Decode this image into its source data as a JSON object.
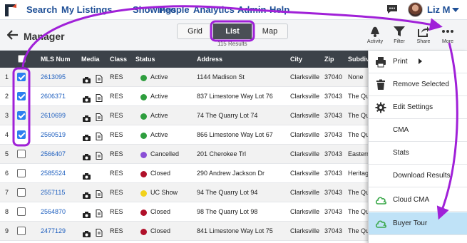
{
  "nav": {
    "links": [
      "Search",
      "My Listings",
      "Showings",
      "People",
      "Analytics",
      "Admin",
      "Help"
    ],
    "user": "Liz M"
  },
  "toolbar": {
    "title": "Manager",
    "views": [
      "Grid",
      "List",
      "Map"
    ],
    "active_view": "List",
    "results": "115 Results",
    "tools": [
      "Activity",
      "Filter",
      "Share",
      "More"
    ]
  },
  "table": {
    "headers": [
      "MLS Num",
      "Media",
      "Class",
      "Status",
      "Address",
      "City",
      "Zip",
      "Subdivi"
    ],
    "rows": [
      {
        "num": "1",
        "checked": true,
        "mls": "2613095",
        "docs": true,
        "cls": "RES",
        "status": "Active",
        "color": "#2e9e3e",
        "address": "1144 Madison St",
        "city": "Clarksville",
        "zip": "37040",
        "subd": "None"
      },
      {
        "num": "2",
        "checked": true,
        "mls": "2606371",
        "docs": true,
        "cls": "RES",
        "status": "Active",
        "color": "#2e9e3e",
        "address": "837 Limestone Way Lot 76",
        "city": "Clarksville",
        "zip": "37043",
        "subd": "The Qu"
      },
      {
        "num": "3",
        "checked": true,
        "mls": "2610699",
        "docs": true,
        "cls": "RES",
        "status": "Active",
        "color": "#2e9e3e",
        "address": "74 The Quarry Lot 74",
        "city": "Clarksville",
        "zip": "37043",
        "subd": "The Qu"
      },
      {
        "num": "4",
        "checked": true,
        "mls": "2560519",
        "docs": true,
        "cls": "RES",
        "status": "Active",
        "color": "#2e9e3e",
        "address": "866 Limestone Way Lot 67",
        "city": "Clarksville",
        "zip": "37043",
        "subd": "The Qu"
      },
      {
        "num": "5",
        "checked": false,
        "mls": "2566407",
        "docs": true,
        "cls": "RES",
        "status": "Cancelled",
        "color": "#8a4fd6",
        "address": "201 Cherokee Trl",
        "city": "Clarksville",
        "zip": "37043",
        "subd": "Eastern"
      },
      {
        "num": "6",
        "checked": false,
        "mls": "2585524",
        "docs": false,
        "cls": "RES",
        "status": "Closed",
        "color": "#b0102a",
        "address": "290 Andrew Jackson Dr",
        "city": "Clarksville",
        "zip": "37043",
        "subd": "Heritag"
      },
      {
        "num": "7",
        "checked": false,
        "mls": "2557115",
        "docs": true,
        "cls": "RES",
        "status": "UC Show",
        "color": "#f2d21a",
        "address": "94 The Quarry Lot 94",
        "city": "Clarksville",
        "zip": "37043",
        "subd": "The Qu"
      },
      {
        "num": "8",
        "checked": false,
        "mls": "2564870",
        "docs": true,
        "cls": "RES",
        "status": "Closed",
        "color": "#b0102a",
        "address": "98 The Quarry Lot 98",
        "city": "Clarksville",
        "zip": "37043",
        "subd": "The Qu"
      },
      {
        "num": "9",
        "checked": false,
        "mls": "2477129",
        "docs": true,
        "cls": "RES",
        "status": "Closed",
        "color": "#b0102a",
        "address": "841 Limestone Way Lot 75",
        "city": "Clarksville",
        "zip": "37043",
        "subd": "The Qu"
      }
    ]
  },
  "menu": {
    "items": [
      "Print",
      "Remove Selected",
      "Edit Settings",
      "CMA",
      "Stats",
      "Download Results",
      "Cloud CMA",
      "Buyer Tour"
    ],
    "highlighted": "Buyer Tour"
  },
  "colors": {
    "brand": "#1e4f96",
    "annotation": "#a020d8",
    "link": "#1e5fbf",
    "highlight": "#bfe2f7"
  },
  "icons": [
    "logo-icon",
    "chat-icon",
    "back-arrow-icon",
    "activity-icon",
    "filter-icon",
    "share-icon",
    "more-icon",
    "camera-icon",
    "document-icon",
    "printer-icon",
    "trash-icon",
    "gear-icon",
    "cloud-icon"
  ]
}
